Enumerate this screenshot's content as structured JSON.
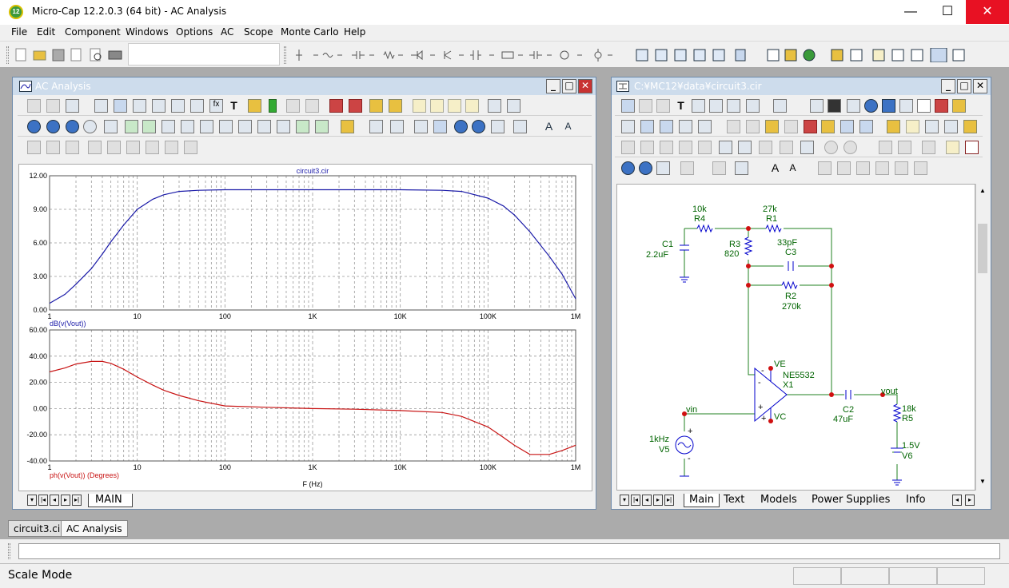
{
  "app": {
    "title": "Micro-Cap 12.2.0.3 (64 bit) - AC Analysis",
    "icon_text": "12"
  },
  "window_controls": {
    "minimize": "—",
    "maximize": "☐",
    "close": "✕"
  },
  "menu": [
    "File",
    "Edit",
    "Component",
    "Windows",
    "Options",
    "AC",
    "Scope",
    "Monte Carlo",
    "Help"
  ],
  "analysis_window": {
    "title": "AC Analysis",
    "sheet_tab": "MAIN",
    "plot_title": "circuit3.cir"
  },
  "schematic_window": {
    "title": "C:¥MC12¥data¥circuit3.cir",
    "tabs": [
      "Main",
      "Text",
      "Models",
      "Power Supplies",
      "Info"
    ],
    "components": {
      "r4": {
        "value": "10k",
        "name": "R4"
      },
      "r1": {
        "value": "27k",
        "name": "R1"
      },
      "c1": {
        "name": "C1",
        "value": "2.2uF"
      },
      "r3": {
        "name": "R3",
        "value": "820"
      },
      "c3": {
        "value": "33pF",
        "name": "C3"
      },
      "r2": {
        "name": "R2",
        "value": "270k"
      },
      "x1": {
        "name": "X1",
        "model": "NE5532"
      },
      "ve": "VE",
      "vc": "VC",
      "vin": "vin",
      "vout": "vout",
      "c2": {
        "name": "C2",
        "value": "47uF"
      },
      "r5": {
        "value": "18k",
        "name": "R5"
      },
      "v5": {
        "value": "1kHz",
        "name": "V5"
      },
      "v6": {
        "value": "1.5V",
        "name": "V6"
      }
    }
  },
  "doc_tabs": [
    "circuit3.cir",
    "AC Analysis"
  ],
  "status": {
    "mode": "Scale Mode"
  },
  "chart_data": [
    {
      "type": "line",
      "title": "circuit3.cir",
      "ylabel": "dB(v(Vout))",
      "xscale": "log",
      "xlim": [
        1,
        1000000
      ],
      "ylim": [
        0,
        12
      ],
      "yticks": [
        "0.00",
        "3.00",
        "6.00",
        "9.00",
        "12.00"
      ],
      "xticks": [
        "1",
        "10",
        "100",
        "1K",
        "10K",
        "100K",
        "1M"
      ],
      "color": "#1a1aa8",
      "x": [
        1,
        1.5,
        2,
        3,
        4,
        5,
        7,
        10,
        15,
        20,
        30,
        50,
        100,
        300,
        1000,
        3000,
        10000,
        30000,
        50000,
        100000,
        150000,
        200000,
        300000,
        500000,
        700000,
        1000000
      ],
      "y": [
        0.6,
        1.4,
        2.3,
        3.7,
        5.0,
        6.1,
        7.6,
        9.0,
        9.9,
        10.3,
        10.6,
        10.7,
        10.75,
        10.75,
        10.75,
        10.75,
        10.75,
        10.7,
        10.6,
        10.0,
        9.3,
        8.5,
        7.0,
        4.8,
        3.2,
        1.0
      ]
    },
    {
      "type": "line",
      "ylabel": "ph(v(Vout)) (Degrees)",
      "xlabel": "F (Hz)",
      "xscale": "log",
      "xlim": [
        1,
        1000000
      ],
      "ylim": [
        -40,
        60
      ],
      "yticks": [
        "-40.00",
        "-20.00",
        "0.00",
        "20.00",
        "40.00",
        "60.00"
      ],
      "xticks": [
        "1",
        "10",
        "100",
        "1K",
        "10K",
        "100K",
        "1M"
      ],
      "color": "#c81414",
      "x": [
        1,
        1.5,
        2,
        3,
        4,
        5,
        7,
        10,
        15,
        20,
        30,
        50,
        100,
        300,
        1000,
        3000,
        10000,
        30000,
        50000,
        100000,
        150000,
        200000,
        300000,
        500000,
        700000,
        1000000
      ],
      "y": [
        28,
        31,
        34,
        36,
        36,
        34.5,
        30,
        24,
        18,
        14,
        10,
        6,
        2,
        1,
        0,
        -0.5,
        -1.5,
        -3,
        -6,
        -14,
        -22,
        -28,
        -35,
        -35,
        -32,
        -28
      ]
    }
  ]
}
